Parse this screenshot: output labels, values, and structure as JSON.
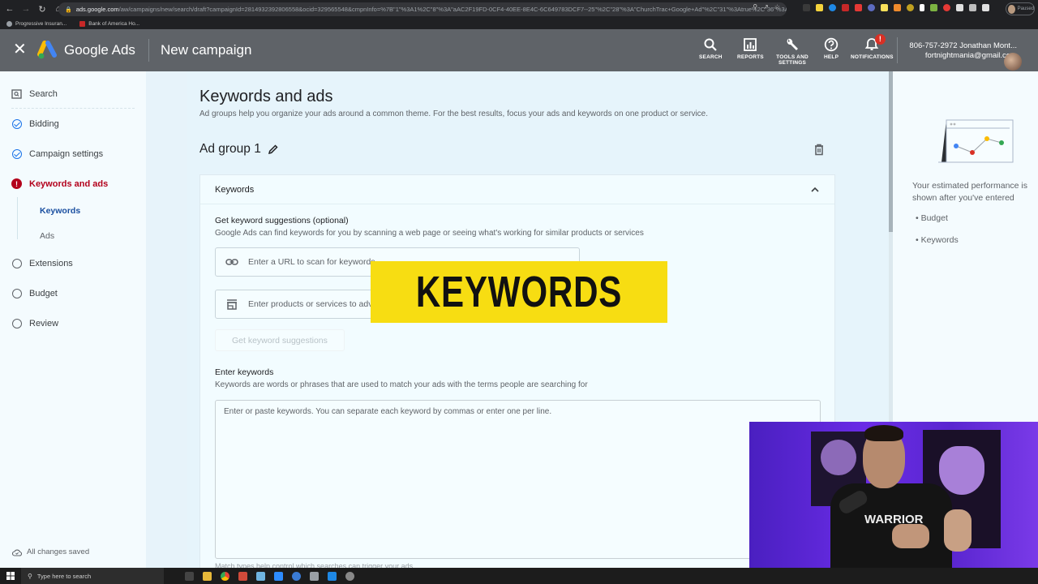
{
  "browser": {
    "url_host": "ads.google.com",
    "url_path": "/aw/campaigns/new/search/draft?campaignId=2814932392806558&ocid=329565548&cmpnInfo=%7B\"1\"%3A1%2C\"8\"%3A\"aAC2F19FD-0CF4-40EE-8E4C-6C649783DCF7--25\"%2C\"28\"%3A\"ChurchTrac+Google+Ad\"%2C\"31\"%3Atrue%2C\"36\"%3Atrue%2C\"...",
    "bookmarks": [
      "Progressive Insuran...",
      "Bank of America Ho..."
    ],
    "profile_label": "Paused",
    "nav_icons": [
      "back-icon",
      "forward-icon",
      "reload-icon",
      "home-icon"
    ],
    "omnibox_icons": [
      "search-icon",
      "share-icon",
      "star-icon"
    ]
  },
  "header": {
    "brand": "Google Ads",
    "page_title": "New campaign",
    "buttons": [
      {
        "label": "SEARCH",
        "icon": "search-icon"
      },
      {
        "label": "REPORTS",
        "icon": "reports-icon"
      },
      {
        "label": "TOOLS AND SETTINGS",
        "icon": "wrench-icon"
      },
      {
        "label": "HELP",
        "icon": "help-icon"
      },
      {
        "label": "NOTIFICATIONS",
        "icon": "bell-icon",
        "badge": "!"
      }
    ],
    "account_name": "806-757-2972 Jonathan Mont...",
    "account_email": "fortnightmania@gmail.com"
  },
  "sidebar": {
    "items": [
      {
        "label": "Search",
        "status": "campaign-type"
      },
      {
        "label": "Bidding",
        "status": "done"
      },
      {
        "label": "Campaign settings",
        "status": "done"
      },
      {
        "label": "Keywords and ads",
        "status": "error"
      },
      {
        "label": "Extensions",
        "status": "todo"
      },
      {
        "label": "Budget",
        "status": "todo"
      },
      {
        "label": "Review",
        "status": "todo"
      }
    ],
    "subitems": [
      {
        "label": "Keywords",
        "active": true
      },
      {
        "label": "Ads",
        "active": false
      }
    ],
    "save_status": "All changes saved"
  },
  "main": {
    "title": "Keywords and ads",
    "subtitle": "Ad groups help you organize your ads around a common theme. For the best results, focus your ads and keywords on one product or service.",
    "ad_group_name": "Ad group 1",
    "card": {
      "header": "Keywords",
      "suggestions_title": "Get keyword suggestions (optional)",
      "suggestions_sub": "Google Ads can find keywords for you by scanning a web page or seeing what's working for similar products or services",
      "url_placeholder": "Enter a URL to scan for keywords",
      "products_placeholder": "Enter products or services to advertise",
      "suggest_button": "Get keyword suggestions",
      "enter_title": "Enter keywords",
      "enter_sub": "Keywords are words or phrases that are used to match your ads with the terms people are searching for",
      "keywords_placeholder": "Enter or paste keywords. You can separate each keyword by commas or enter one per line.",
      "match_types_text": "Match types help control which searches can trigger your ads"
    }
  },
  "right_panel": {
    "text": "Your estimated performance is shown after you've entered",
    "items": [
      "Budget",
      "Keywords"
    ],
    "illustration_colors": [
      "#4285f4",
      "#d93025",
      "#fbbc04",
      "#34a853"
    ]
  },
  "overlay": {
    "caption": "KEYWORDS",
    "color": "#f7dd12"
  },
  "webcam": {
    "shirt_text": "WARRIOR"
  },
  "taskbar": {
    "search_placeholder": "Type here to search",
    "apps": [
      "task-view",
      "file-explorer",
      "chrome",
      "app",
      "app",
      "zoom",
      "skype",
      "app",
      "app",
      "app"
    ]
  }
}
